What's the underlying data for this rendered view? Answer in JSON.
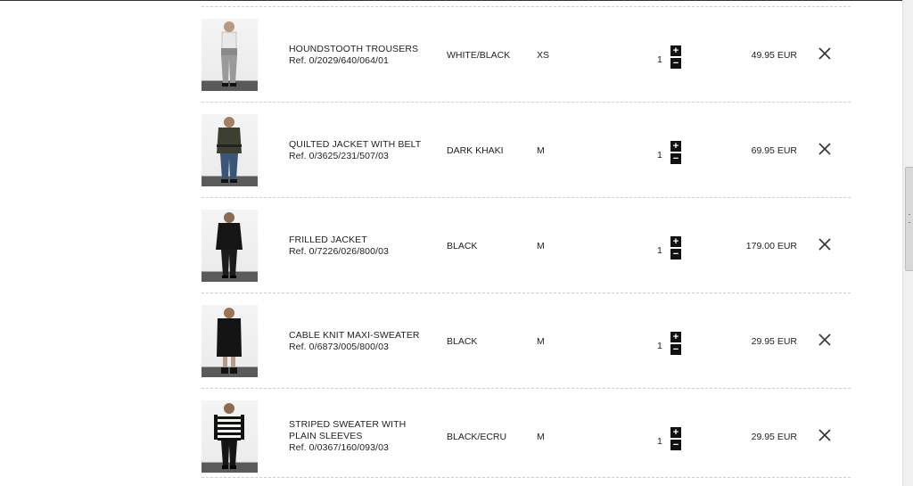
{
  "cart": {
    "items": [
      {
        "name": "HOUNDSTOOTH TROUSERS",
        "ref": "Ref. 0/2029/640/064/01",
        "color": "WHITE/BLACK",
        "size": "XS",
        "qty": "1",
        "price": "49.95 EUR",
        "thumb": "gray-trousers"
      },
      {
        "name": "QUILTED JACKET WITH BELT",
        "ref": "Ref. 0/3625/231/507/03",
        "color": "DARK KHAKI",
        "size": "M",
        "qty": "1",
        "price": "69.95 EUR",
        "thumb": "khaki-jacket"
      },
      {
        "name": "FRILLED JACKET",
        "ref": "Ref. 0/7226/026/800/03",
        "color": "BLACK",
        "size": "M",
        "qty": "1",
        "price": "179.00 EUR",
        "thumb": "black-jacket"
      },
      {
        "name": "CABLE KNIT MAXI-SWEATER",
        "ref": "Ref. 0/6873/005/800/03",
        "color": "BLACK",
        "size": "M",
        "qty": "1",
        "price": "29.95 EUR",
        "thumb": "black-sweater"
      },
      {
        "name": "STRIPED SWEATER WITH PLAIN SLEEVES",
        "ref": "Ref. 0/0367/160/093/03",
        "color": "BLACK/ECRU",
        "size": "M",
        "qty": "1",
        "price": "29.95 EUR",
        "thumb": "striped-sweater"
      }
    ],
    "increase_symbol": "+",
    "decrease_symbol": "−"
  },
  "colors": {
    "text": "#222222",
    "button": "#111111",
    "divider": "#cfcfcf"
  }
}
